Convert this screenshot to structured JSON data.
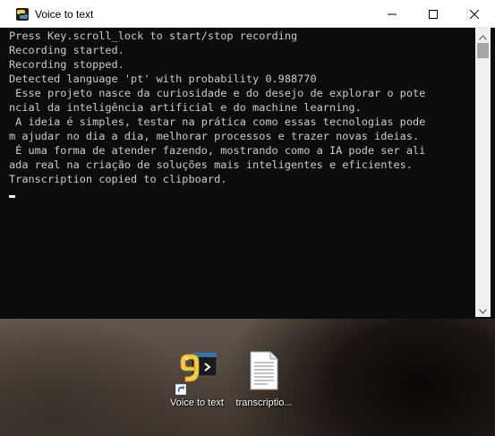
{
  "window": {
    "title": "Voice to text",
    "icon": "python-icon",
    "controls": {
      "minimize": "minimize-icon",
      "maximize": "maximize-icon",
      "close": "close-icon"
    }
  },
  "console": {
    "lines": [
      "Press Key.scroll_lock to start/stop recording",
      "Recording started.",
      "Recording stopped.",
      "Detected language 'pt' with probability 0.988770",
      " Esse projeto nasce da curiosidade e do desejo de explorar o pote",
      "ncial da inteligência artificial e do machine learning.",
      " A ideia é simples, testar na prática como essas tecnologias pode",
      "m ajudar no dia a dia, melhorar processos e trazer novas ideias.",
      " É uma forma de atender fazendo, mostrando como a IA pode ser ali",
      "ada real na criação de soluções mais inteligentes e eficientes.",
      "Transcription copied to clipboard."
    ],
    "colors": {
      "background": "#0c0c0c",
      "text": "#cccccc"
    }
  },
  "desktop": {
    "icons": [
      {
        "label": "Voice to text",
        "icon": "python-shortcut-icon"
      },
      {
        "label": "transcriptio...",
        "icon": "text-file-icon"
      }
    ]
  }
}
